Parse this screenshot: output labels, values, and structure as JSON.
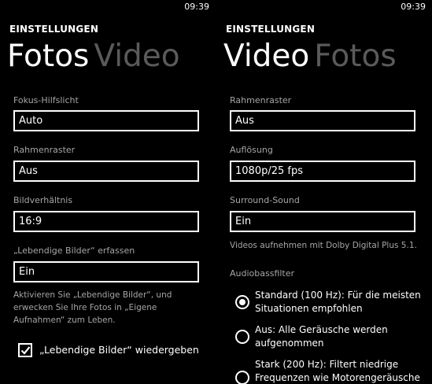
{
  "status_bar": {
    "time_left": "09:39",
    "time_right": "09:39"
  },
  "photo_settings": {
    "app_title": "EINSTELLUNGEN",
    "pivot_active": "Fotos",
    "pivot_inactive": "Video",
    "fields": [
      {
        "label": "Fokus-Hilfslicht",
        "value": "Auto"
      },
      {
        "label": "Rahmenraster",
        "value": "Aus"
      },
      {
        "label": "Bildverhältnis",
        "value": "16:9"
      },
      {
        "label": "„Lebendige Bilder“ erfassen",
        "value": "Ein"
      }
    ],
    "living_images_desc": "Aktivieren Sie „Lebendige Bilder“, und erwecken Sie Ihre Fotos in „Eigene Aufnahmen“ zum Leben.",
    "playback_checkbox": {
      "label": "„Lebendige Bilder“ wiedergeben",
      "checked": true
    }
  },
  "video_settings": {
    "app_title": "EINSTELLUNGEN",
    "pivot_active": "Video",
    "pivot_inactive": "Fotos",
    "fields": [
      {
        "label": "Rahmenraster",
        "value": "Aus"
      },
      {
        "label": "Auflösung",
        "value": "1080p/25 fps"
      },
      {
        "label": "Surround-Sound",
        "value": "Ein"
      }
    ],
    "surround_desc": "Videos aufnehmen mit Dolby Digital Plus 5.1.",
    "bass_filter": {
      "label": "Audiobassfilter",
      "options": [
        {
          "text": "Standard (100 Hz): Für die meisten Situationen empfohlen",
          "selected": true
        },
        {
          "text": "Aus: Alle Geräusche werden aufgenommen",
          "selected": false
        },
        {
          "text": "Stark (200 Hz): Filtert niedrige Frequenzen wie Motorengeräusche",
          "selected": false
        }
      ]
    }
  }
}
